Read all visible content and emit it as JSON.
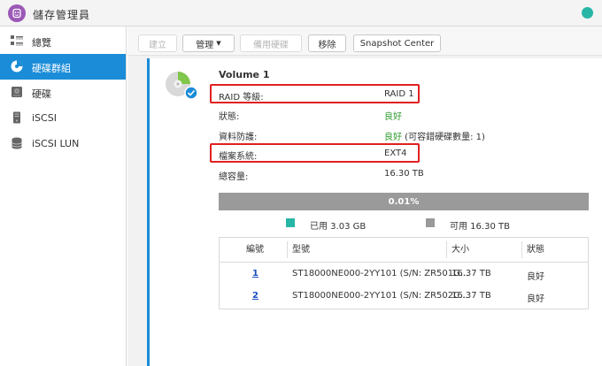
{
  "app": {
    "title": "儲存管理員"
  },
  "sidebar": {
    "items": [
      {
        "label": "總覽"
      },
      {
        "label": "硬碟群組"
      },
      {
        "label": "硬碟"
      },
      {
        "label": "iSCSI"
      },
      {
        "label": "iSCSI LUN"
      }
    ]
  },
  "toolbar": {
    "create_label": "建立",
    "manage_label": "管理",
    "spare_label": "備用硬碟",
    "remove_label": "移除",
    "snapshot_label": "Snapshot Center"
  },
  "volume": {
    "name": "Volume 1",
    "properties": [
      {
        "label": "RAID 等級:",
        "value": "RAID 1",
        "highlighted": true
      },
      {
        "label": "狀態:",
        "value": "良好",
        "status": "good"
      },
      {
        "label": "資料防護:",
        "value": "良好",
        "value_suffix": " (可容錯硬碟數量: 1)",
        "status": "good"
      },
      {
        "label": "檔案系統:",
        "value": "EXT4",
        "highlighted": true
      },
      {
        "label": "總容量:",
        "value": "16.30 TB"
      }
    ]
  },
  "usage": {
    "percent_label": "0.01%",
    "used_fraction": 0.0001,
    "used_legend": "已用 3.03 GB",
    "free_legend": "可用 16.30 TB",
    "used_color": "#27b6a6",
    "free_color": "#9a9a9a"
  },
  "disk_table": {
    "headers": [
      "編號",
      "型號",
      "大小",
      "狀態"
    ],
    "rows": [
      {
        "id": "1",
        "model": "ST18000NE000-2YY101 (S/N: ZR501G...",
        "size": "16.37 TB",
        "status": "良好"
      },
      {
        "id": "2",
        "model": "ST18000NE000-2YY101 (S/N: ZR502C...",
        "size": "16.37 TB",
        "status": "良好"
      }
    ]
  },
  "colors": {
    "accent": "#1a8cd8",
    "good": "#2e9b2e",
    "highlight_box": "#e02020"
  }
}
